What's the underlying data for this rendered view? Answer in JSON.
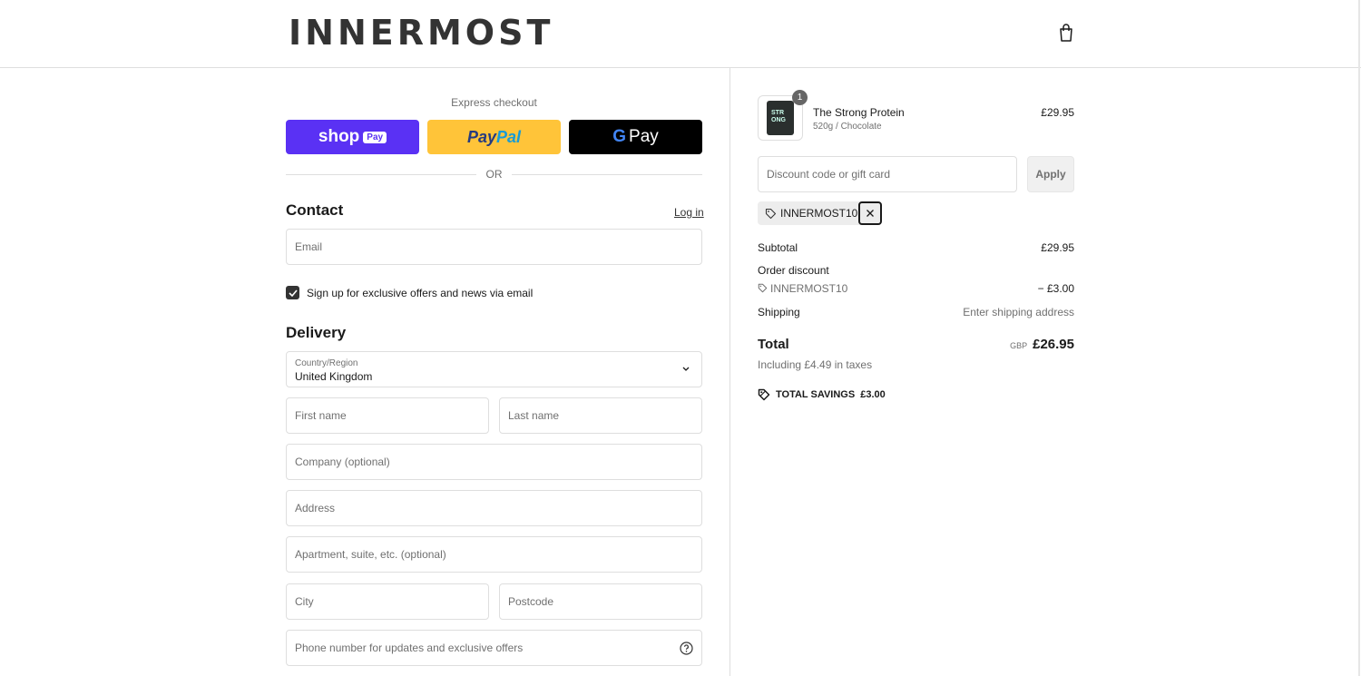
{
  "header": {
    "logo": "INNERMOST",
    "cart_icon": "shopping-bag-icon"
  },
  "express": {
    "title": "Express checkout",
    "shop_pay": {
      "main": "shop",
      "tag": "Pay"
    },
    "paypal": {
      "part1": "Pay",
      "part2": "Pal"
    },
    "gpay": {
      "g": "G",
      "label": "Pay"
    },
    "or": "OR"
  },
  "contact": {
    "title": "Contact",
    "login": "Log in",
    "email_placeholder": "Email",
    "newsletter_label": "Sign up for exclusive offers and news via email",
    "newsletter_checked": true
  },
  "delivery": {
    "title": "Delivery",
    "country_label": "Country/Region",
    "country_value": "United Kingdom",
    "first_name_placeholder": "First name",
    "last_name_placeholder": "Last name",
    "company_placeholder": "Company (optional)",
    "address_placeholder": "Address",
    "apartment_placeholder": "Apartment, suite, etc. (optional)",
    "city_placeholder": "City",
    "postcode_placeholder": "Postcode",
    "phone_placeholder": "Phone number for updates and exclusive offers"
  },
  "summary": {
    "product": {
      "name": "The Strong Protein",
      "variant": "520g / Chocolate",
      "price": "£29.95",
      "quantity": "1",
      "pack_text": "STR\nONG"
    },
    "discount_placeholder": "Discount code or gift card",
    "apply_label": "Apply",
    "applied_code": "INNERMOST10",
    "subtotal_label": "Subtotal",
    "subtotal_value": "£29.95",
    "order_discount_label": "Order discount",
    "discount_code": "INNERMOST10",
    "discount_value": "− £3.00",
    "shipping_label": "Shipping",
    "shipping_value": "Enter shipping address",
    "total_label": "Total",
    "currency": "GBP",
    "total_value": "£26.95",
    "taxes_note": "Including £4.49 in taxes",
    "savings_label": "TOTAL SAVINGS",
    "savings_value": "£3.00"
  },
  "colors": {
    "shop_pay": "#5a31f4",
    "paypal": "#ffc439",
    "gpay": "#000000",
    "border": "#dedede"
  }
}
